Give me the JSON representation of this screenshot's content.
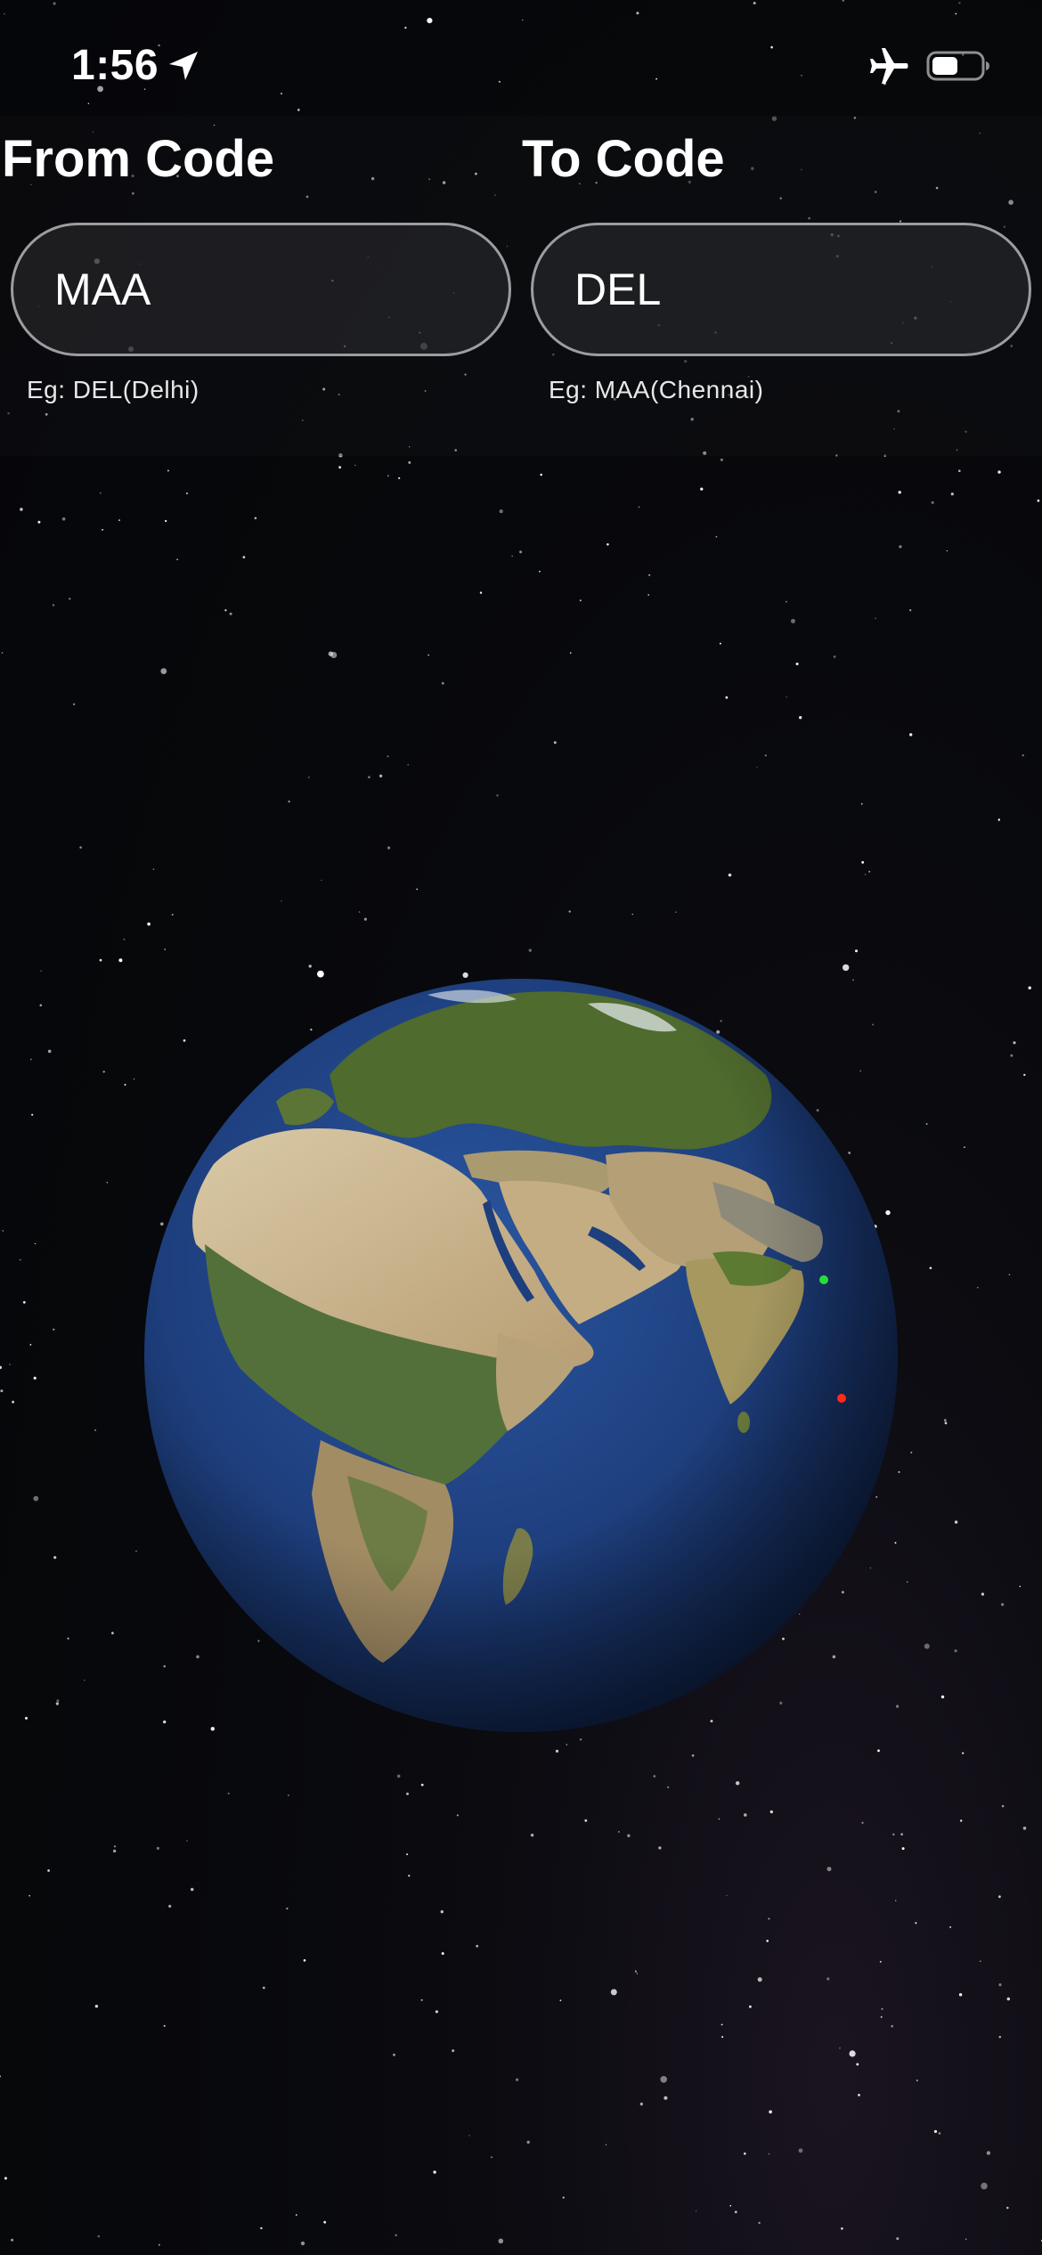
{
  "status_bar": {
    "time": "1:56",
    "location_icon": "location-arrow-icon",
    "airplane_icon": "airplane-mode-icon",
    "battery_icon": "battery-icon"
  },
  "from_field": {
    "title": "From Code",
    "value": "MAA",
    "hint": "Eg: DEL(Delhi)"
  },
  "to_field": {
    "title": "To Code",
    "value": "DEL",
    "hint": "Eg: MAA(Chennai)"
  },
  "globe": {
    "origin_marker_color": "#ff2a1a",
    "destination_marker_color": "#22e03a"
  },
  "colors": {
    "background": "#07080b",
    "ocean": "#1e3f7e",
    "text": "#ffffff"
  }
}
